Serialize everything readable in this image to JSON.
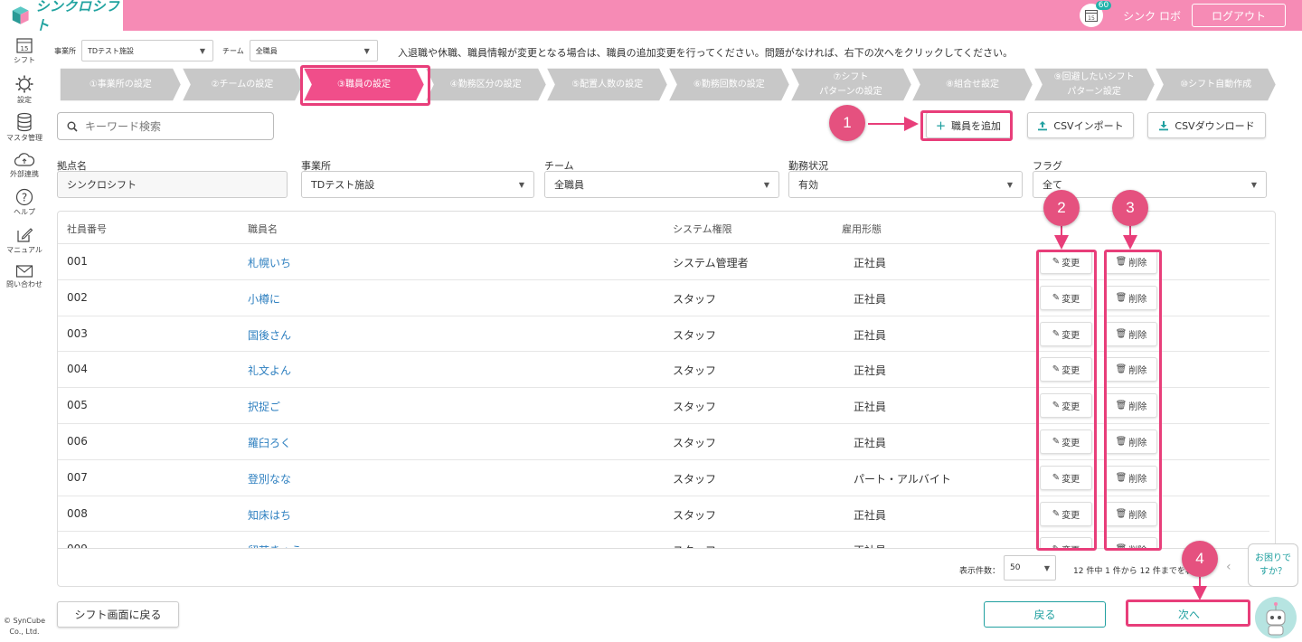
{
  "app": {
    "logo_text": "シンクロシフト",
    "calendar_day": "15",
    "notification_count": "60",
    "user_name": "シンク ロボ",
    "logout_label": "ログアウト"
  },
  "sidebar": {
    "items": [
      {
        "label": "シフト",
        "icon": "calendar-icon"
      },
      {
        "label": "設定",
        "icon": "gear-icon"
      },
      {
        "label": "マスタ管理",
        "icon": "database-icon"
      },
      {
        "label": "外部連携",
        "icon": "cloud-icon"
      },
      {
        "label": "ヘルプ",
        "icon": "help-icon"
      },
      {
        "label": "マニュアル",
        "icon": "pencil-note-icon"
      },
      {
        "label": "問い合わせ",
        "icon": "mail-icon"
      }
    ],
    "copyright_line1": "© SynCube",
    "copyright_line2": "Co., Ltd."
  },
  "filters_top": {
    "office_label": "事業所",
    "office_value": "TDテスト施設",
    "team_label": "チーム",
    "team_value": "全職員",
    "info_text": "入退職や休職、職員情報が変更となる場合は、職員の追加変更を行ってください。問題がなければ、右下の次へをクリックしてください。"
  },
  "steps": [
    {
      "line1": "①事業所の設定",
      "line2": ""
    },
    {
      "line1": "②チームの設定",
      "line2": ""
    },
    {
      "line1": "③職員の設定",
      "line2": ""
    },
    {
      "line1": "④勤務区分の設定",
      "line2": ""
    },
    {
      "line1": "⑤配置人数の設定",
      "line2": ""
    },
    {
      "line1": "⑥勤務回数の設定",
      "line2": ""
    },
    {
      "line1": "⑦シフト",
      "line2": "パターンの設定"
    },
    {
      "line1": "⑧組合せ設定",
      "line2": ""
    },
    {
      "line1": "⑨回避したいシフト",
      "line2": "パターン設定"
    },
    {
      "line1": "⑩シフト自動作成",
      "line2": ""
    }
  ],
  "toolbar": {
    "search_placeholder": "キーワード検索",
    "add_staff_label": "職員を追加",
    "csv_import_label": "CSVインポート",
    "csv_download_label": "CSVダウンロード"
  },
  "form": {
    "base_label": "拠点名",
    "base_value": "シンクロシフト",
    "office_label": "事業所",
    "office_value": "TDテスト施設",
    "team_label": "チーム",
    "team_value": "全職員",
    "status_label": "勤務状況",
    "status_value": "有効",
    "flag_label": "フラグ",
    "flag_value": "全て"
  },
  "table": {
    "headers": [
      "社員番号",
      "職員名",
      "システム権限",
      "雇用形態"
    ],
    "edit_label": "変更",
    "delete_label": "削除",
    "rows": [
      {
        "id": "001",
        "name": "札幌いち",
        "role": "システム管理者",
        "type": "正社員"
      },
      {
        "id": "002",
        "name": "小樽に",
        "role": "スタッフ",
        "type": "正社員"
      },
      {
        "id": "003",
        "name": "国後さん",
        "role": "スタッフ",
        "type": "正社員"
      },
      {
        "id": "004",
        "name": "礼文よん",
        "role": "スタッフ",
        "type": "正社員"
      },
      {
        "id": "005",
        "name": "択捉ご",
        "role": "スタッフ",
        "type": "正社員"
      },
      {
        "id": "006",
        "name": "羅臼ろく",
        "role": "スタッフ",
        "type": "正社員"
      },
      {
        "id": "007",
        "name": "登別なな",
        "role": "スタッフ",
        "type": "パート・アルバイト"
      },
      {
        "id": "008",
        "name": "知床はち",
        "role": "スタッフ",
        "type": "正社員"
      },
      {
        "id": "009",
        "name": "留萌きゅう",
        "role": "スタッフ",
        "type": "正社員"
      }
    ],
    "per_page_label": "表示件数：",
    "per_page_value": "50",
    "summary": "12 件中 1 件から 12 件までを表示"
  },
  "footer": {
    "back_to_shift_label": "シフト画面に戻る",
    "back_label": "戻る",
    "next_label": "次へ",
    "help_text_line1": "お困りで",
    "help_text_line2": "すか？"
  },
  "annotations": {
    "marker_1": "1",
    "marker_2": "2",
    "marker_3": "3",
    "marker_4": "4"
  },
  "colors": {
    "brand_pink": "#f68bb5",
    "accent_teal": "#20a0a0",
    "highlight": "#e83e7a",
    "step_active": "#f04e8a",
    "step_inactive": "#c8c8c8",
    "link_blue": "#2f80c0"
  }
}
